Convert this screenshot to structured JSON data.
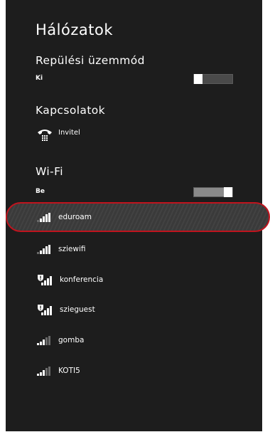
{
  "panel": {
    "title": "Hálózatok"
  },
  "airplane": {
    "title": "Repülési üzemmód",
    "state_label": "Ki",
    "on": false
  },
  "connections": {
    "title": "Kapcsolatok",
    "items": [
      {
        "label": "Invitel",
        "icon": "phone-dialup-icon"
      }
    ]
  },
  "wifi": {
    "title": "Wi-Fi",
    "state_label": "Be",
    "on": true,
    "networks": [
      {
        "label": "eduroam",
        "icon": "wifi-signal-icon",
        "secured_warning": false,
        "selected": true
      },
      {
        "label": "sziewifi",
        "icon": "wifi-signal-icon",
        "secured_warning": false,
        "selected": false
      },
      {
        "label": "konferencia",
        "icon": "wifi-warning-icon",
        "secured_warning": true,
        "selected": false
      },
      {
        "label": "szieguest",
        "icon": "wifi-warning-icon",
        "secured_warning": true,
        "selected": false
      },
      {
        "label": "gomba",
        "icon": "wifi-signal-icon",
        "secured_warning": false,
        "selected": false
      },
      {
        "label": "KOTI5",
        "icon": "wifi-signal-icon",
        "secured_warning": false,
        "selected": false
      }
    ]
  },
  "colors": {
    "panel_bg": "#1d1d1d",
    "highlight_border": "#c0141e"
  }
}
